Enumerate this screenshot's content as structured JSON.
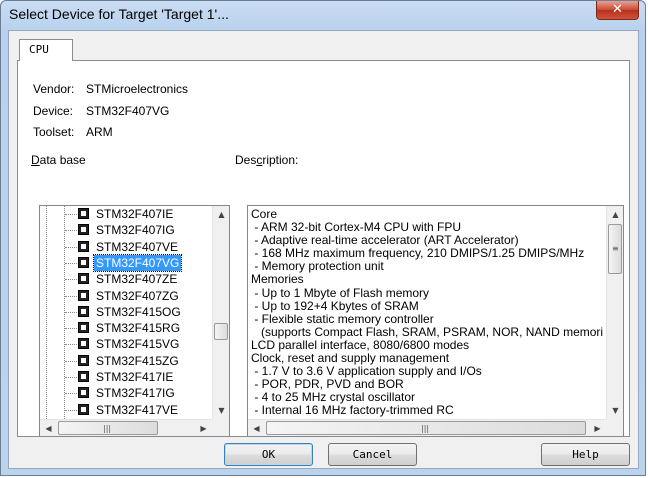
{
  "window": {
    "title": "Select Device for Target 'Target 1'..."
  },
  "tabs": [
    {
      "label": "CPU",
      "selected": true
    }
  ],
  "device_info": {
    "vendor_label": "Vendor:",
    "vendor": "STMicroelectronics",
    "device_label": "Device:",
    "device": "STM32F407VG",
    "toolset_label": "Toolset:",
    "toolset": "ARM"
  },
  "database": {
    "label_prefix": "D",
    "label_rest": "ata base",
    "items": [
      "STM32F407IE",
      "STM32F407IG",
      "STM32F407VE",
      "STM32F407VG",
      "STM32F407ZE",
      "STM32F407ZG",
      "STM32F415OG",
      "STM32F415RG",
      "STM32F415VG",
      "STM32F415ZG",
      "STM32F417IE",
      "STM32F417IG",
      "STM32F417VE"
    ],
    "selected": "STM32F407VG"
  },
  "description": {
    "label_prefix": "Des",
    "label_mid": "c",
    "label_rest": "ription:",
    "lines": [
      "Core",
      " - ARM 32-bit Cortex-M4 CPU with FPU",
      " - Adaptive real-time accelerator (ART Accelerator)",
      " - 168 MHz maximum frequency, 210 DMIPS/1.25 DMIPS/MHz",
      " - Memory protection unit",
      "Memories",
      " - Up to 1 Mbyte of Flash memory",
      " - Up to 192+4 Kbytes of SRAM",
      " - Flexible static memory controller",
      "   (supports Compact Flash, SRAM, PSRAM, NOR, NAND memories)",
      "LCD parallel interface, 8080/6800 modes",
      "Clock, reset and supply management",
      " - 1.7 V to 3.6 V application supply and I/Os",
      " - POR, PDR, PVD and BOR",
      " - 4 to 25 MHz crystal oscillator",
      " - Internal 16 MHz factory-trimmed RC"
    ]
  },
  "buttons": {
    "ok": "OK",
    "cancel": "Cancel",
    "help": "Help"
  },
  "icons": {
    "close": "close-icon",
    "chip": "chip-icon"
  },
  "colors": {
    "selection": "#3399ff",
    "close_button": "#c74a35"
  }
}
